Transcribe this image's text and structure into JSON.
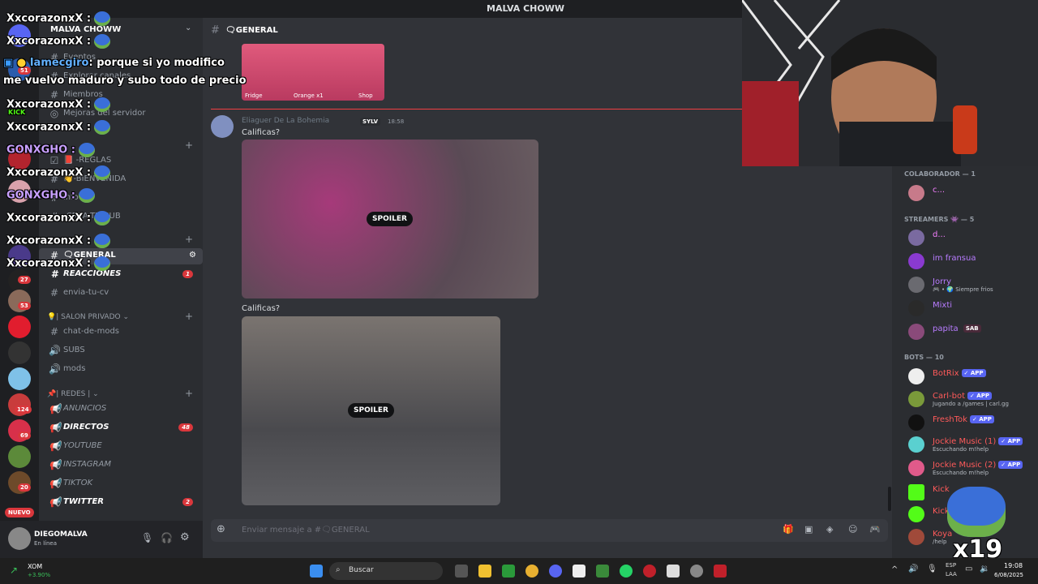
{
  "window": {
    "title": "MALVA CHOWW"
  },
  "sidebar": {
    "server_name": "MALVA CHOWW",
    "items": [
      {
        "icon": "#",
        "label": "Eventos"
      },
      {
        "icon": "#",
        "label": "Explorar canales"
      },
      {
        "icon": "#",
        "label": "Miembros"
      },
      {
        "icon": "◎",
        "label": "Mejoras del servidor"
      }
    ],
    "channels": [
      {
        "icon": "☑",
        "label": "📕 -REGLAS"
      },
      {
        "icon": "#",
        "label": "👋-BIENVENIDA"
      },
      {
        "icon": "#",
        "label": "info"
      },
      {
        "icon": "#",
        "label": "-CREA-TU-SUB"
      },
      {
        "icon": "#",
        "label": "🗨GENERAL",
        "badge": ""
      },
      {
        "icon": "#",
        "label": "REACCIONES",
        "badge": "1"
      },
      {
        "icon": "#",
        "label": "envia-tu-cv"
      }
    ],
    "category_privado": "💡| SALON PRIVADO ⌄",
    "privado_channels": [
      {
        "icon": "#",
        "label": "chat-de-mods"
      },
      {
        "icon": "🔊",
        "label": "SUBS"
      },
      {
        "icon": "🔊",
        "label": "mods"
      }
    ],
    "category_redes": "📌| REDES | ⌄",
    "redes_channels": [
      {
        "icon": "📢",
        "label": "ANUNCIOS",
        "badge": ""
      },
      {
        "icon": "📢",
        "label": "DIRECTOS",
        "badge": "48"
      },
      {
        "icon": "📢",
        "label": "YOUTUBE",
        "badge": ""
      },
      {
        "icon": "📢",
        "label": "INSTAGRAM",
        "badge": ""
      },
      {
        "icon": "📢",
        "label": "TIKTOK",
        "badge": ""
      },
      {
        "icon": "📢",
        "label": "TWITTER",
        "badge": "2"
      }
    ]
  },
  "rail": {
    "badges": [
      "51",
      "27",
      "53",
      "124",
      "69",
      "20"
    ],
    "new_label": "NUEVO"
  },
  "user": {
    "name": "DIEGOMALVA",
    "status": "En línea"
  },
  "channel": {
    "name": "🗨GENERAL"
  },
  "messages": {
    "author": "Eliaguer De La Bohemia",
    "tag": "SYLV",
    "time": "18:58",
    "text1": "Calificas?",
    "text2": "Calificas?",
    "spoiler": "SPOILER",
    "top_image_labels": [
      "Fridge",
      "Orange x1",
      "Shop"
    ]
  },
  "composer": {
    "placeholder": "Enviar mensaje a #🗨GENERAL"
  },
  "members": {
    "sections": [
      {
        "title": "COLABORADOR — 1",
        "items": [
          {
            "name": "c...",
            "color": "#f47fff",
            "sub": ""
          }
        ]
      },
      {
        "title": "STREAMERS 👾 — 5",
        "items": [
          {
            "name": "d...",
            "color": "#f47fff",
            "sub": ""
          },
          {
            "name": "im fransua",
            "color": "#b87cff",
            "sub": ""
          },
          {
            "name": "Jorry",
            "color": "#b87cff",
            "sub": "🎮 • 🌍 Siempre frios"
          },
          {
            "name": "Mixti",
            "color": "#b87cff",
            "sub": ""
          },
          {
            "name": "papita",
            "color": "#b87cff",
            "sub": "",
            "tag": "SAB"
          }
        ]
      },
      {
        "title": "BOTS — 10",
        "items": [
          {
            "name": "BotRix",
            "color": "#ff5a5a",
            "sub": "",
            "app": "✓ APP"
          },
          {
            "name": "Carl-bot",
            "color": "#ff5a5a",
            "sub": "Jugando a /games | carl.gg",
            "app": "✓ APP"
          },
          {
            "name": "FreshTok",
            "color": "#ff5a5a",
            "sub": "",
            "app": "✓ APP"
          },
          {
            "name": "Jockie Music (1)",
            "color": "#ff5a5a",
            "sub": "Escuchando m!help",
            "app": "✓ APP"
          },
          {
            "name": "Jockie Music (2)",
            "color": "#ff5a5a",
            "sub": "Escuchando m!help",
            "app": "✓ APP"
          },
          {
            "name": "Kick",
            "color": "#ff5a5a",
            "sub": "",
            "app": ""
          },
          {
            "name": "Kick",
            "color": "#ff5a5a",
            "sub": "",
            "app": ""
          },
          {
            "name": "Koya",
            "color": "#ff5a5a",
            "sub": "/help",
            "app": ""
          }
        ]
      }
    ]
  },
  "overlay": {
    "chat": [
      {
        "user": "XxcorazonxX :",
        "color": "#ffffff",
        "text": ""
      },
      {
        "user": "XxcorazonxX :",
        "color": "#ffffff",
        "text": ""
      },
      {
        "user": "Iamecgiro",
        "color": "#62b0ff",
        "text": ": porque si yo modifico",
        "line2": "me vuelvo maduro y subo todo de precio"
      },
      {
        "user": "XxcorazonxX :",
        "color": "#ffffff",
        "text": ""
      },
      {
        "user": "XxcorazonxX :",
        "color": "#ffffff",
        "text": ""
      },
      {
        "user": "GONXGHO :",
        "color": "#c8a0ff",
        "text": ""
      },
      {
        "user": "XxcorazonxX :",
        "color": "#ffffff",
        "text": ""
      },
      {
        "user": "GONXGHO :",
        "color": "#c8a0ff",
        "text": ""
      },
      {
        "user": "XxcorazonxX :",
        "color": "#ffffff",
        "text": ""
      },
      {
        "user": "XxcorazonxX :",
        "color": "#ffffff",
        "text": ""
      },
      {
        "user": "XxcorazonxX :",
        "color": "#ffffff",
        "text": ""
      }
    ],
    "kick_label": "KICK",
    "emote_count": "x19"
  },
  "taskbar": {
    "stock": "XOM",
    "stock_change": "+3.90%",
    "search": "Buscar",
    "lang1": "ESP",
    "lang2": "LAA",
    "time": "19:08",
    "date": "6/08/2025"
  }
}
